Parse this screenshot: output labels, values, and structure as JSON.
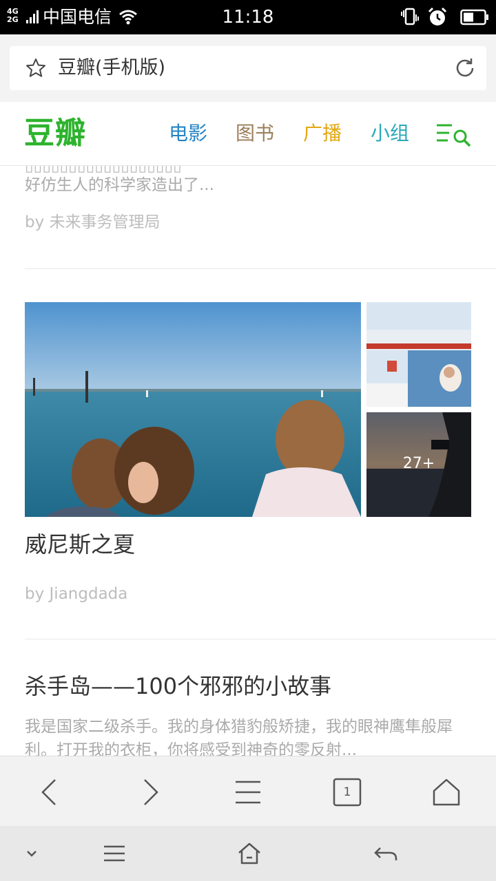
{
  "status_bar": {
    "network_top": "4G",
    "network_bottom": "2G",
    "carrier": "中国电信",
    "time": "11:18",
    "icons": [
      "signal-icon",
      "wifi-icon",
      "vibrate-icon",
      "alarm-icon",
      "battery-icon"
    ]
  },
  "address_bar": {
    "title": "豆瓣(手机版)",
    "icons": [
      "star-icon",
      "reload-icon"
    ]
  },
  "header": {
    "logo": "豆瓣",
    "nav": [
      "电影",
      "图书",
      "广播",
      "小组"
    ],
    "nav_colors": [
      "#2384c6",
      "#9c7e5a",
      "#e4a813",
      "#2aa8b8"
    ],
    "brand_color": "#2db32d",
    "menu_icon": "menu-search-icon"
  },
  "feed": {
    "item1": {
      "excerpt": "好仿生人的科学家造出了...",
      "author": "by 未来事务管理局"
    },
    "item2": {
      "title": "威尼斯之夏",
      "more_photos": "27+",
      "author": "by Jiangdada"
    },
    "item3": {
      "title": "杀手岛——100个邪邪的小故事",
      "excerpt": "我是国家二级杀手。我的身体猎豹般矫捷，我的眼神鹰隼般犀利。打开我的衣柜，你将感受到神奇的零反射..."
    }
  },
  "browser_toolbar": {
    "tab_count": "1",
    "icons": [
      "back-icon",
      "forward-icon",
      "menu-icon",
      "tabs-icon",
      "home-icon"
    ]
  },
  "system_nav": {
    "icons": [
      "chevron-down-icon",
      "menu-icon",
      "home-icon",
      "back-icon"
    ]
  }
}
